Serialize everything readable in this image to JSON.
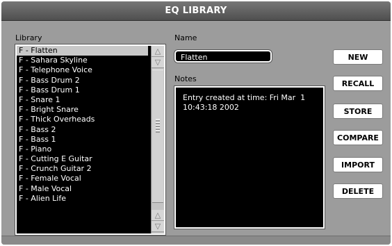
{
  "window": {
    "title": "EQ LIBRARY"
  },
  "library": {
    "label": "Library",
    "items": [
      "F - Flatten",
      "F - Sahara Skyline",
      "F - Telephone Voice",
      "F - Bass Drum 2",
      "F - Bass Drum 1",
      "F - Snare 1",
      "F - Bright Snare",
      "F - Thick Overheads",
      "F - Bass 2",
      "F - Bass 1",
      "F - Piano",
      "F - Cutting E Guitar",
      "F - Crunch Guitar 2",
      "F - Female Vocal",
      "F - Male Vocal",
      "F - Alien Life"
    ],
    "selected_index": 0
  },
  "name": {
    "label": "Name",
    "value": "Flatten"
  },
  "notes": {
    "label": "Notes",
    "value": "Entry created at time: Fri Mar  1\n10:43:18 2002"
  },
  "buttons": {
    "new": "NEW",
    "recall": "RECALL",
    "store": "STORE",
    "compare": "COMPARE",
    "import": "IMPORT",
    "delete": "DELETE"
  },
  "scroll": {
    "up_arrow": "△",
    "down_arrow": "▽"
  },
  "colors": {
    "title_bar": "#5f5f5f",
    "panel": "#9c9c9c",
    "field_bg": "#000000",
    "selected_row": "#c8c8c8"
  }
}
